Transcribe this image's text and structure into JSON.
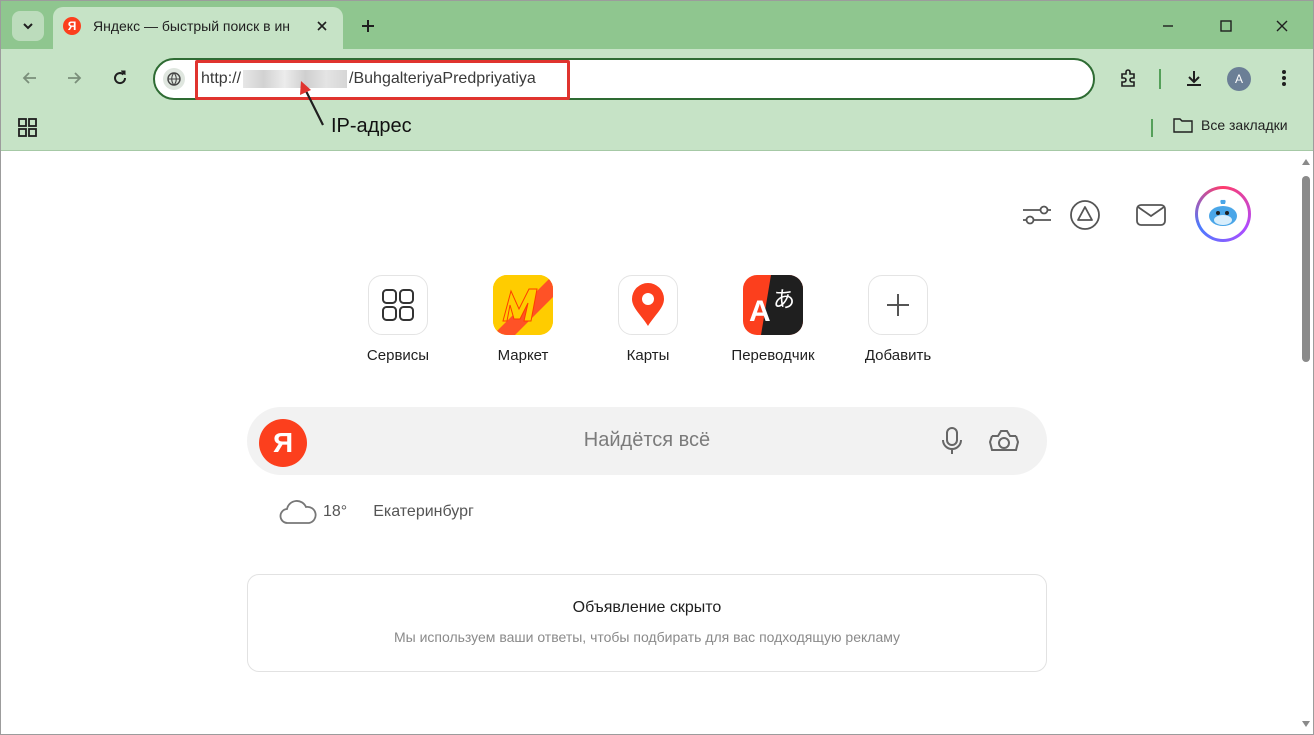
{
  "tab": {
    "title": "Яндекс — быстрый поиск в ин",
    "favicon_letter": "Я"
  },
  "omnibox": {
    "url_prefix": "http://",
    "url_path": "/BuhgalteriyaPredpriyatiya"
  },
  "annotation": {
    "label": "IP-адрес"
  },
  "toolbar": {
    "profile_initial": "A"
  },
  "bookmarks_bar": {
    "all_bookmarks_label": "Все закладки"
  },
  "services": [
    {
      "label": "Сервисы",
      "icon": "grid-icon"
    },
    {
      "label": "Маркет",
      "icon": "market-icon"
    },
    {
      "label": "Карты",
      "icon": "map-pin-icon"
    },
    {
      "label": "Переводчик",
      "icon": "translate-icon"
    },
    {
      "label": "Добавить",
      "icon": "plus-icon"
    }
  ],
  "search": {
    "logo_letter": "Я",
    "placeholder": "Найдётся всё"
  },
  "weather": {
    "temperature": "18°",
    "city": "Екатеринбург"
  },
  "ad_card": {
    "title": "Объявление скрыто",
    "subtitle": "Мы используем ваши ответы, чтобы подбирать для вас подходящую рекламу"
  },
  "colors": {
    "frame_green": "#8fc68f",
    "toolbar_green": "#c6e3c6",
    "yandex_red": "#fc3f1d",
    "highlight_red": "#e0342f"
  }
}
